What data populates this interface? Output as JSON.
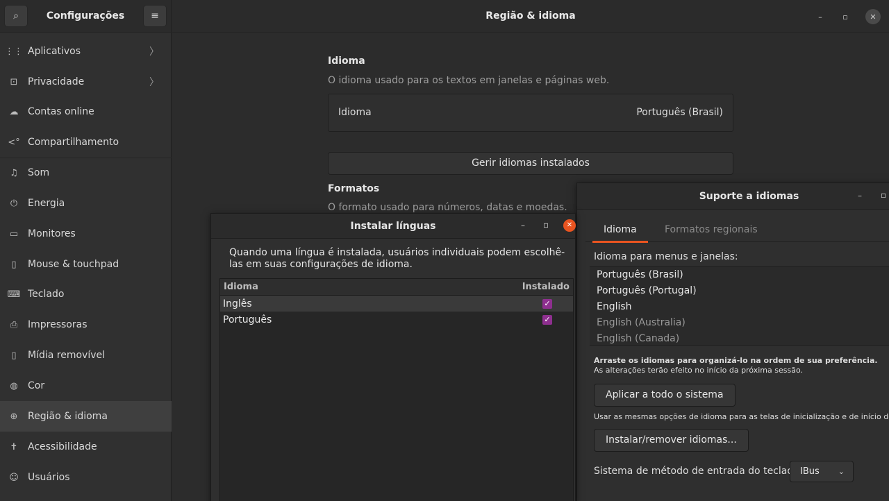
{
  "sidebar": {
    "title": "Configurações",
    "search_icon": "search-icon",
    "menu_icon": "hamburger-menu-icon",
    "items": [
      {
        "label": "Aplicativos",
        "icon": "⋯",
        "chevron": true
      },
      {
        "label": "Privacidade",
        "icon": "🔒",
        "chevron": true
      },
      {
        "label": "Contas online",
        "icon": "☁"
      },
      {
        "label": "Compartilhamento",
        "icon": "⋖"
      },
      {
        "label": "Som",
        "icon": "♫"
      },
      {
        "label": "Energia",
        "icon": "⓵"
      },
      {
        "label": "Monitores",
        "icon": "▭"
      },
      {
        "label": "Mouse & touchpad",
        "icon": "◯"
      },
      {
        "label": "Teclado",
        "icon": "⌨"
      },
      {
        "label": "Impressoras",
        "icon": "⎙"
      },
      {
        "label": "Mídia removível",
        "icon": "▯"
      },
      {
        "label": "Cor",
        "icon": "◍"
      },
      {
        "label": "Região & idioma",
        "icon": "⊕",
        "selected": true
      },
      {
        "label": "Acessibilidade",
        "icon": "✝"
      },
      {
        "label": "Usuários",
        "icon": "☺"
      }
    ]
  },
  "main": {
    "title": "Região & idioma",
    "idioma_title": "Idioma",
    "idioma_desc": "O idioma usado para os textos em janelas e páginas web.",
    "idioma_row_label": "Idioma",
    "idioma_row_value": "Português (Brasil)",
    "manage_button": "Gerir idiomas instalados",
    "formatos_title": "Formatos",
    "formatos_desc": "O formato usado para números, datas e moedas."
  },
  "install_dialog": {
    "title": "Instalar línguas",
    "description": "Quando uma língua é instalada, usuários individuais podem escolhê-las em suas configurações de idioma.",
    "col_language": "Idioma",
    "col_installed": "Instalado",
    "rows": [
      {
        "language": "Inglês",
        "installed": "✓"
      },
      {
        "language": "Português",
        "installed": "✓"
      }
    ]
  },
  "support_dialog": {
    "title": "Suporte a idiomas",
    "tab_language": "Idioma",
    "tab_formats": "Formatos regionais",
    "menus_label": "Idioma para menus e janelas:",
    "languages": [
      "Português (Brasil)",
      "Português (Portugal)",
      "English",
      "English (Australia)",
      "English (Canada)"
    ],
    "drag_hint": "Arraste os idiomas para organizá-lo na ordem de sua preferência.",
    "effect_hint": "As alterações terão efeito no início da próxima sessão.",
    "apply_button": "Aplicar a todo o sistema",
    "login_hint": "Usar as mesmas opções de idioma para as telas de inicialização e de início de sess",
    "install_remove_button": "Instalar/remover idiomas...",
    "input_method_label": "Sistema de método de entrada do teclado:",
    "input_method_value": "IBus",
    "colors": {
      "accent": "#e95420",
      "check": "#8e2f8f"
    }
  }
}
